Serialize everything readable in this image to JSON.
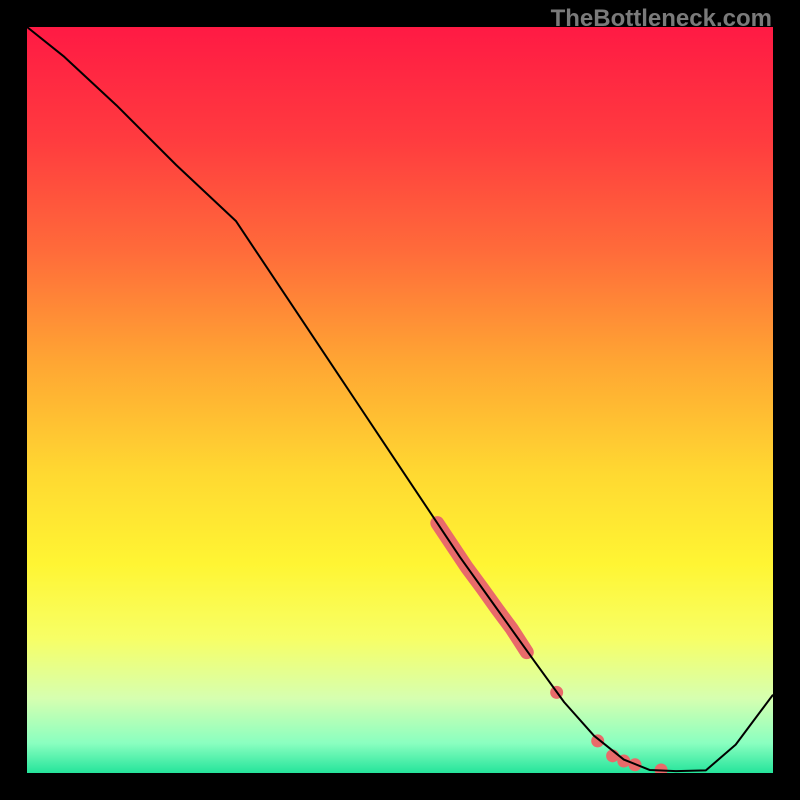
{
  "watermark": "TheBottleneck.com",
  "chart_data": {
    "type": "line",
    "title": "",
    "xlabel": "",
    "ylabel": "",
    "xlim": [
      0,
      100
    ],
    "ylim": [
      0,
      100
    ],
    "grid": false,
    "background_gradient": {
      "stops": [
        {
          "offset": 0.0,
          "color": "#ff1a44"
        },
        {
          "offset": 0.15,
          "color": "#ff3b3f"
        },
        {
          "offset": 0.3,
          "color": "#ff6b3a"
        },
        {
          "offset": 0.45,
          "color": "#ffa633"
        },
        {
          "offset": 0.6,
          "color": "#ffd931"
        },
        {
          "offset": 0.72,
          "color": "#fff533"
        },
        {
          "offset": 0.82,
          "color": "#f7ff66"
        },
        {
          "offset": 0.9,
          "color": "#d6ffb0"
        },
        {
          "offset": 0.96,
          "color": "#8affc0"
        },
        {
          "offset": 1.0,
          "color": "#25e49b"
        }
      ]
    },
    "series": [
      {
        "name": "bottleneck-curve",
        "color": "#000000",
        "stroke_width": 2,
        "x": [
          0,
          5,
          12,
          20,
          28,
          36,
          44,
          52,
          58,
          63,
          68,
          72,
          76,
          80,
          83.5,
          87,
          91,
          95,
          100
        ],
        "y": [
          100,
          96,
          89.5,
          81.5,
          74,
          62,
          50,
          38,
          29,
          22,
          15,
          9.5,
          5,
          1.8,
          0.4,
          0.25,
          0.35,
          3.8,
          10.5
        ]
      }
    ],
    "highlight_segments": [
      {
        "name": "thick-segment-upper",
        "color": "#e96a6a",
        "stroke_width": 14,
        "linecap": "round",
        "x": [
          55,
          57,
          59,
          61,
          63,
          65,
          67
        ],
        "y": [
          33.5,
          30.5,
          27.5,
          24.8,
          22,
          19.3,
          16.2
        ]
      }
    ],
    "scatter": [
      {
        "name": "dots-lower",
        "color": "#e96a6a",
        "radius": 6.5,
        "points": [
          {
            "x": 71.0,
            "y": 10.8
          },
          {
            "x": 76.5,
            "y": 4.3
          },
          {
            "x": 78.5,
            "y": 2.3
          },
          {
            "x": 80.0,
            "y": 1.6
          },
          {
            "x": 81.5,
            "y": 1.1
          },
          {
            "x": 85.0,
            "y": 0.4
          }
        ]
      }
    ]
  }
}
